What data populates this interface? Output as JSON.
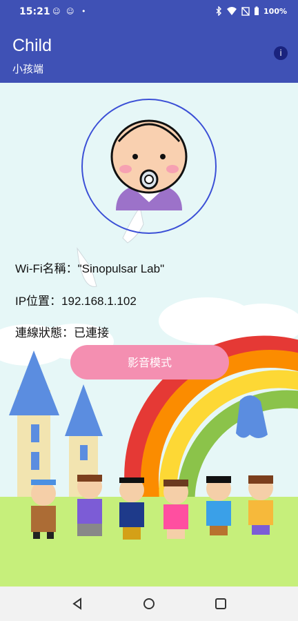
{
  "status_bar": {
    "time": "15:21",
    "battery": "100%",
    "notif1": "☺",
    "notif2": "☺",
    "dot": "•"
  },
  "app_bar": {
    "title": "Child",
    "subtitle": "小孩端",
    "info_icon": "i"
  },
  "info": {
    "wifi": "Wi-Fi名稱：\"Sinopulsar Lab\"",
    "ip": "IP位置：192.168.1.102",
    "status": "連線狀態：已連接"
  },
  "media_button": {
    "label": "影音模式"
  },
  "colors": {
    "primary": "#3f51b5",
    "button": "#f48fb1",
    "ring": "#3b4fd6"
  }
}
